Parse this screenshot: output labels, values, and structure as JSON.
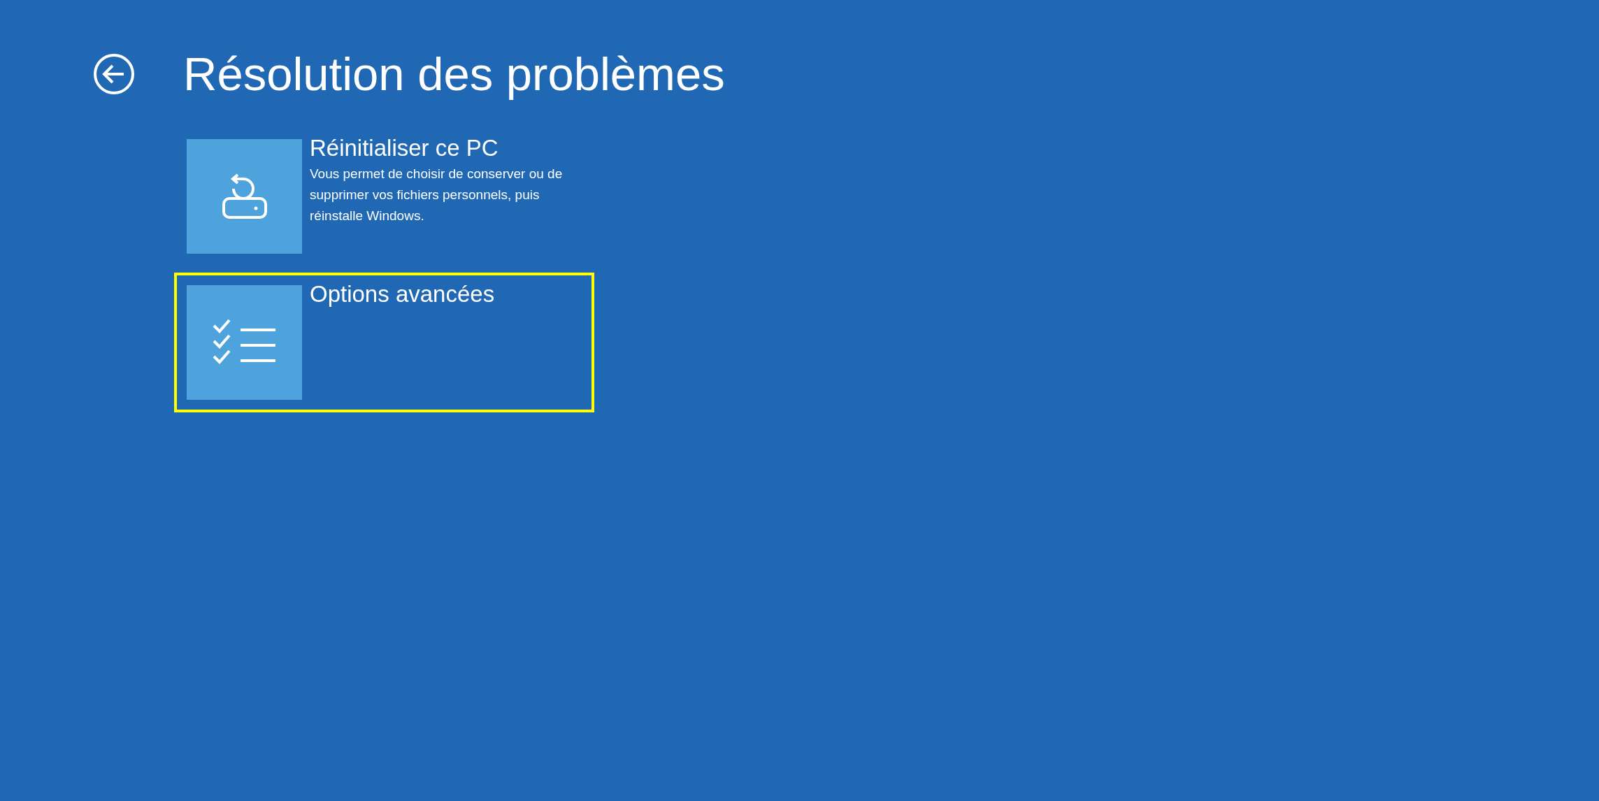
{
  "header": {
    "title": "Résolution des problèmes"
  },
  "options": [
    {
      "kind": "reset",
      "title": "Réinitialiser ce PC",
      "description": "Vous permet de choisir de conserver ou de supprimer vos fichiers personnels, puis réinstalle Windows.",
      "highlighted": false
    },
    {
      "kind": "advanced",
      "title": "Options avancées",
      "highlighted": true
    }
  ]
}
